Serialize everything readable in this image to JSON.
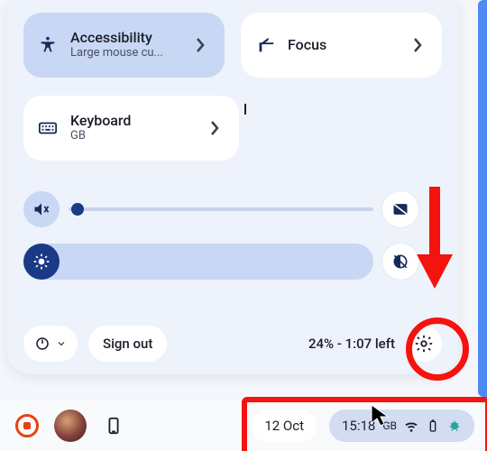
{
  "tiles": {
    "accessibility": {
      "title": "Accessibility",
      "subtitle": "Large mouse cu..."
    },
    "focus": {
      "title": "Focus"
    },
    "keyboard": {
      "title": "Keyboard",
      "subtitle": "GB"
    }
  },
  "footer": {
    "signout": "Sign out",
    "battery": "24% - 1:07 left"
  },
  "shelf": {
    "date": "12 Oct",
    "time": "15:18",
    "lang": "GB"
  }
}
